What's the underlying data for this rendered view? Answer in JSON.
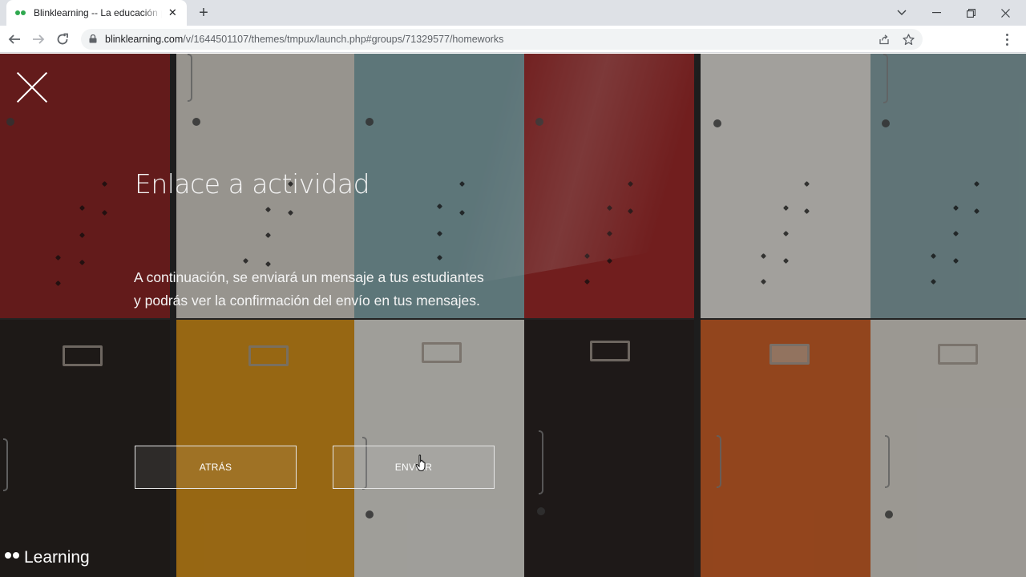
{
  "browser": {
    "tab_title": "Blinklearning -- La educación per",
    "tab_close_glyph": "✕",
    "new_tab_glyph": "+",
    "url_host": "blinklearning.com",
    "url_path": "/v/1644501107/themes/tmpux/launch.php#groups/71329577/homeworks",
    "favicon_color": "#2fa84f"
  },
  "page": {
    "headline": "Enlace a actividad",
    "message": "A continuación, se enviará un mensaje a tus estudiantes  y podrás ver la confirmación del envío en tus mensajes.",
    "back_button": "ATRÁS",
    "send_button": "ENVIAR",
    "brand_text": "Learning"
  },
  "colors": {
    "text": "#f4f4f4",
    "locker_red": "#9b2a2a",
    "locker_white": "#e6e4de",
    "locker_teal": "#8fb0b5",
    "locker_black": "#2b2624",
    "locker_orange": "#d46a2a",
    "locker_yellow": "#e0a020"
  }
}
